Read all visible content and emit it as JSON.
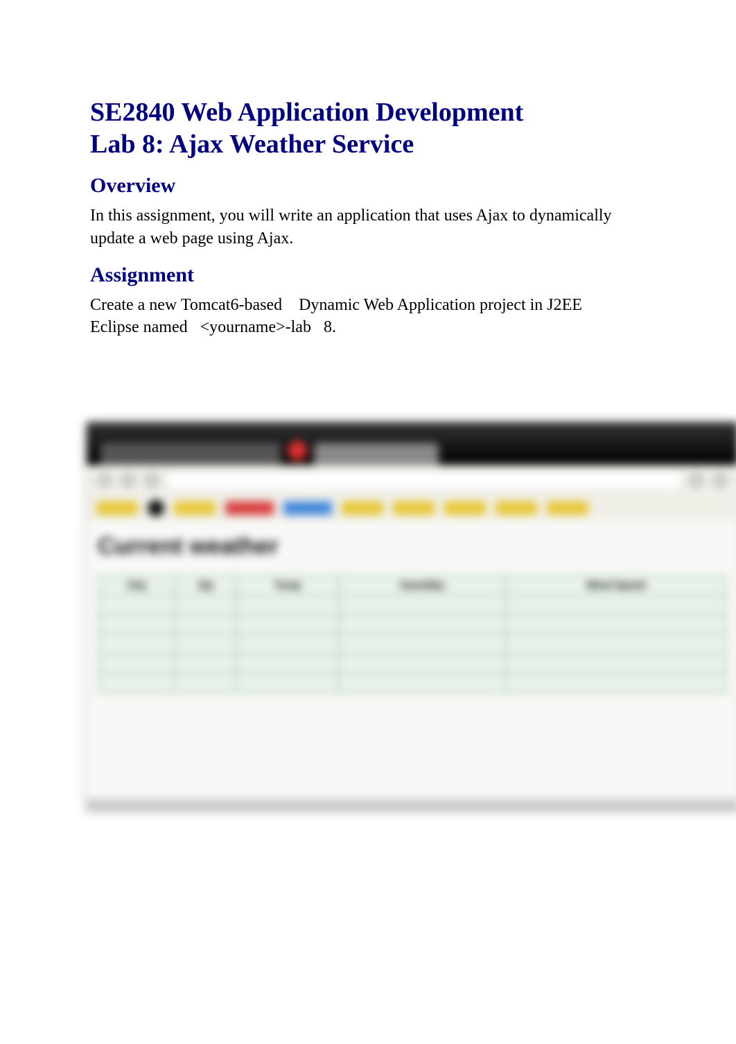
{
  "title": {
    "line1": "SE2840 Web Application Development",
    "line2": "Lab 8: Ajax Weather Service"
  },
  "sections": {
    "overview": {
      "heading": "Overview",
      "body": "In this assignment, you will write an application that uses Ajax to dynamically update a web page using Ajax."
    },
    "assignment": {
      "heading": "Assignment",
      "body": "Create a new Tomcat6-based    Dynamic Web Application project in J2EE Eclipse named   <yourname>-lab   8."
    }
  },
  "blurred_screenshot": {
    "page_heading": "Current weather",
    "table": {
      "headers": [
        "City",
        "Zip",
        "Temp",
        "Humidity",
        "Wind Speed"
      ],
      "rows": [
        [
          "",
          "",
          "",
          "",
          ""
        ],
        [
          "",
          "",
          "",
          "",
          ""
        ],
        [
          "",
          "",
          "",
          "",
          ""
        ],
        [
          "",
          "",
          "",
          "",
          ""
        ],
        [
          "",
          "",
          "",
          "",
          ""
        ]
      ]
    }
  }
}
